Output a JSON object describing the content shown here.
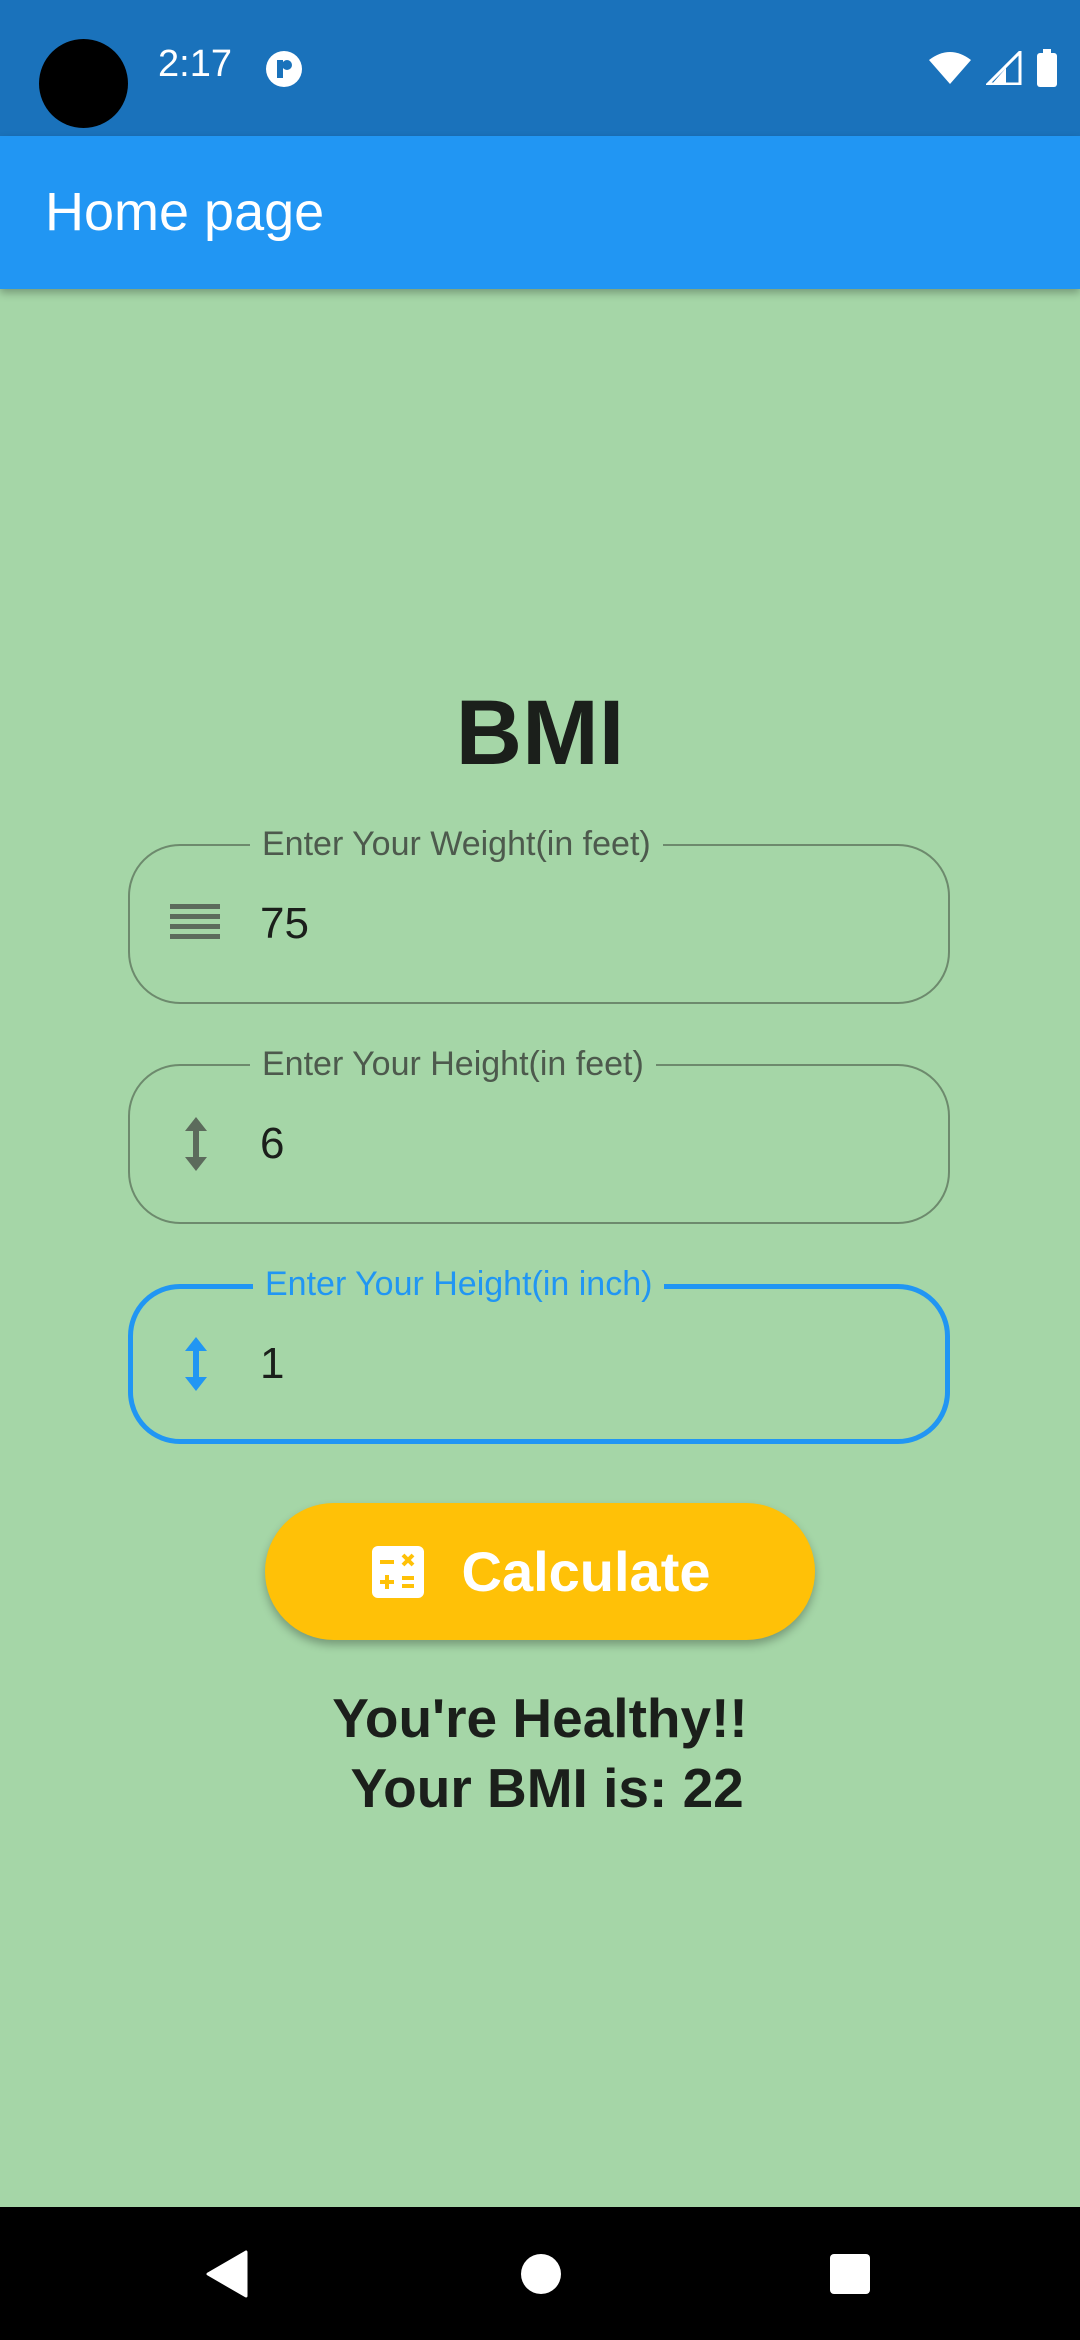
{
  "status_bar": {
    "time": "2:17"
  },
  "app_bar": {
    "title": "Home page"
  },
  "main": {
    "title": "BMI",
    "fields": [
      {
        "label": "Enter Your Weight(in feet)",
        "value": "75",
        "icon": "weight-lines-icon"
      },
      {
        "label": "Enter Your Height(in feet)",
        "value": "6",
        "icon": "height-arrows-icon"
      },
      {
        "label": "Enter Your Height(in inch)",
        "value": "1",
        "icon": "height-arrows-icon"
      }
    ],
    "button": {
      "label": "Calculate",
      "icon": "calculator-icon"
    },
    "result": {
      "line1": "You're Healthy!!",
      "line2": " Your BMI is: 22"
    }
  },
  "colors": {
    "background": "#a5d6a7",
    "status_bar": "#1a72bb",
    "app_bar": "#2196f3",
    "button": "#ffc107",
    "focus": "#2196f3"
  }
}
